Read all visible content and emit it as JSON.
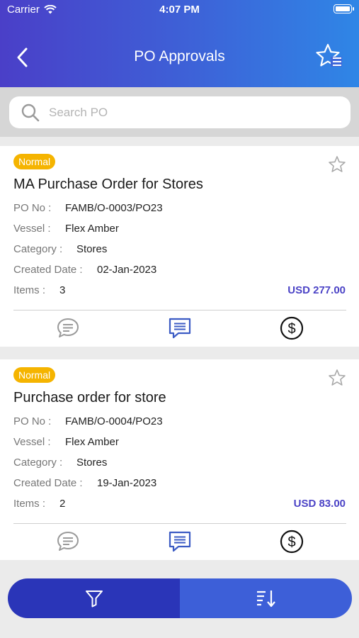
{
  "status_bar": {
    "carrier": "Carrier",
    "time": "4:07 PM"
  },
  "header": {
    "title": "PO Approvals"
  },
  "search": {
    "placeholder": "Search PO",
    "value": ""
  },
  "labels": {
    "po_no": "PO No :",
    "vessel": "Vessel :",
    "category": "Category :",
    "created_date": "Created Date :",
    "items": "Items :"
  },
  "orders": [
    {
      "priority": "Normal",
      "title": "MA Purchase Order for Stores",
      "po_no": "FAMB/O-0003/PO23",
      "vessel": "Flex Amber",
      "category": "Stores",
      "created_date": "02-Jan-2023",
      "items": "3",
      "amount": "USD 277.00"
    },
    {
      "priority": "Normal",
      "title": "Purchase order for store",
      "po_no": "FAMB/O-0004/PO23",
      "vessel": "Flex Amber",
      "category": "Stores",
      "created_date": "19-Jan-2023",
      "items": "2",
      "amount": "USD 83.00"
    }
  ],
  "icons": {
    "back": "chevron-left-icon",
    "favorites_list": "star-list-icon",
    "search": "search-icon",
    "star": "star-outline-icon",
    "comments": "comments-icon",
    "message": "message-icon",
    "price": "dollar-icon",
    "filter": "filter-icon",
    "sort": "sort-icon"
  },
  "colors": {
    "header_gradient_start": "#4a3fc8",
    "header_gradient_end": "#2f86e6",
    "badge": "#f5b400",
    "amount": "#4b43c6",
    "filter_button": "#2a35b8",
    "sort_button": "#3d5fd8"
  }
}
